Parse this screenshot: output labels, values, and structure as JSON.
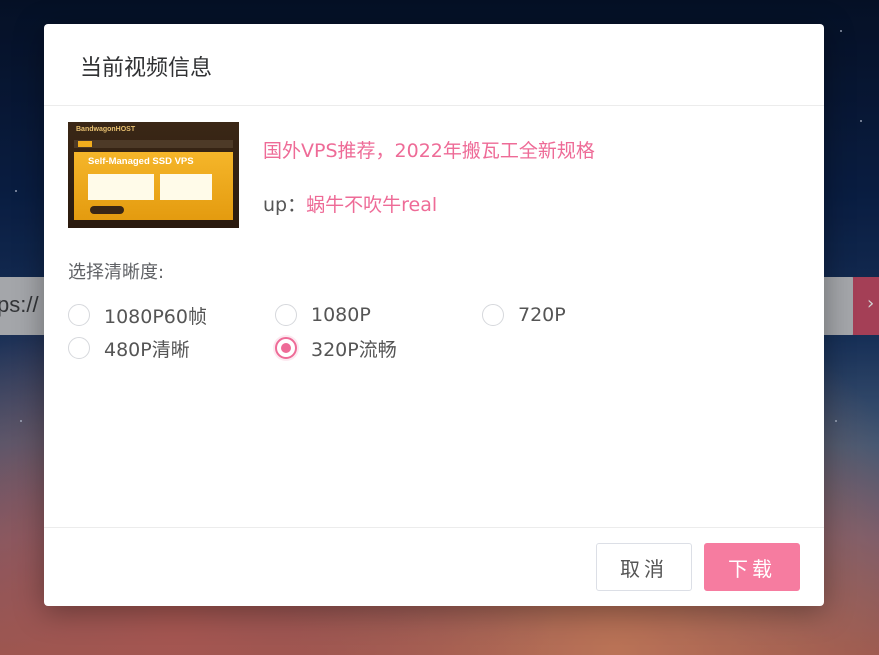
{
  "background": {
    "url_text": "ps://",
    "button_icon": "chevron-icon"
  },
  "modal": {
    "title": "当前视频信息",
    "video": {
      "thumbnail": {
        "brand": "BandwagonHOST",
        "headline": "Self-Managed SSD VPS"
      },
      "title": "国外VPS推荐，2022年搬瓦工全新规格",
      "up_label": "up：",
      "up_name": "蜗牛不吹牛real"
    },
    "quality_label": "选择清晰度:",
    "options": [
      {
        "label": "1080P60帧",
        "checked": false
      },
      {
        "label": "1080P",
        "checked": false
      },
      {
        "label": "720P",
        "checked": false
      },
      {
        "label": "480P清晰",
        "checked": false
      },
      {
        "label": "320P流畅",
        "checked": true
      }
    ],
    "buttons": {
      "cancel": "取消",
      "download": "下载"
    }
  },
  "colors": {
    "accent": "#ee6b97",
    "primary_button": "#f67ca0"
  }
}
